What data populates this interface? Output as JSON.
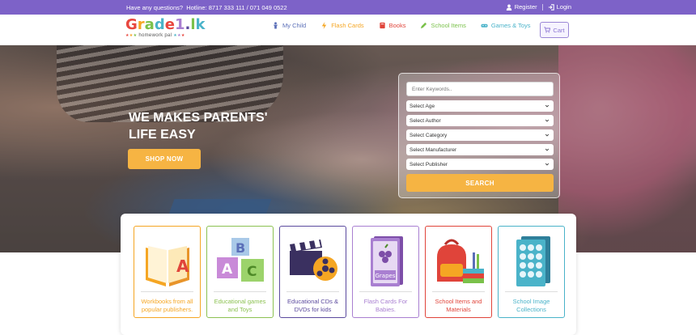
{
  "topbar": {
    "question": "Have any questions?",
    "hotline": "Hotline: 8717 333 111 / 071 049 0522",
    "register": "Register",
    "login": "Login"
  },
  "logo": {
    "word_parts": [
      "G",
      "r",
      "a",
      "d",
      "e",
      "1",
      ".",
      "l",
      "k"
    ],
    "tagline": "homework pal"
  },
  "nav": {
    "items": [
      {
        "label": "My Child",
        "color": "#5b6fb8",
        "icon": "child-icon"
      },
      {
        "label": "Flash Cards",
        "color": "#f5a623",
        "icon": "bolt-icon"
      },
      {
        "label": "Books",
        "color": "#e0443a",
        "icon": "book-icon"
      },
      {
        "label": "School Items",
        "color": "#7ac14a",
        "icon": "pencil-icon"
      },
      {
        "label": "Games & Toys",
        "color": "#4ab3c9",
        "icon": "gamepad-icon"
      }
    ],
    "cart_label": "Cart"
  },
  "hero": {
    "title": "WE MAKES PARENTS' LIFE EASY",
    "shop_now": "SHOP NOW"
  },
  "search": {
    "keyword_placeholder": "Enter Keywords..",
    "selects": [
      "Select Age",
      "Select Author",
      "Select Category",
      "Select Manufacturer",
      "Select Publisher"
    ],
    "button": "SEARCH"
  },
  "categories": [
    {
      "label": "Workbooks from all popular publishers.",
      "color": "#f5a623",
      "icon": "workbook-icon"
    },
    {
      "label": "Educational games and Toys",
      "color": "#8cc152",
      "icon": "abc-blocks-icon"
    },
    {
      "label": "Educational CDs & DVDs for kids",
      "color": "#5b4a9e",
      "icon": "film-reel-icon"
    },
    {
      "label": "Flash Cards For Babies.",
      "color": "#a97fd1",
      "icon": "flash-card-icon"
    },
    {
      "label": "School Items and Materials",
      "color": "#e0443a",
      "icon": "backpack-icon"
    },
    {
      "label": "School Image Collections",
      "color": "#4ab3c9",
      "icon": "image-book-icon"
    }
  ],
  "colors": {
    "topbar": "#7d62c8",
    "accent": "#f6b443"
  }
}
